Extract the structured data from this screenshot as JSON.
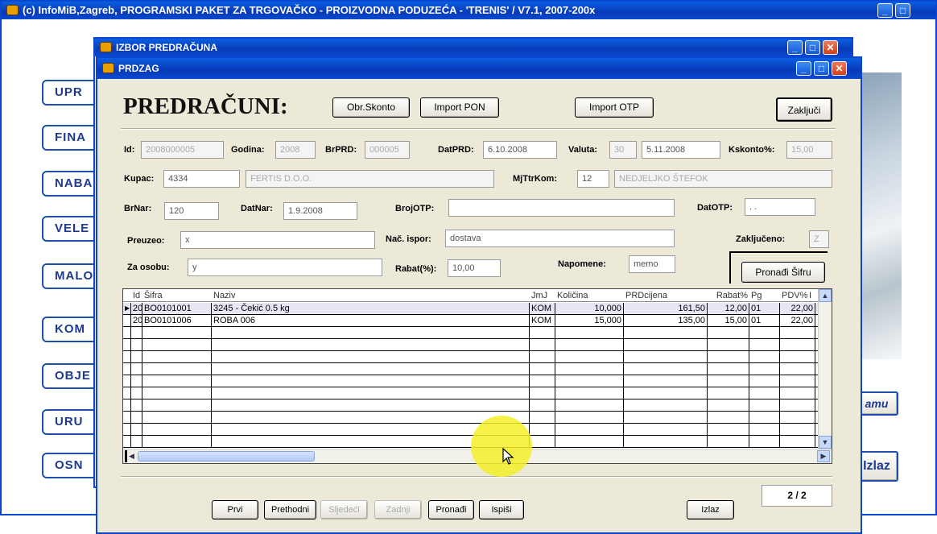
{
  "main_window": {
    "title": "(c) InfoMiB,Zagreb, PROGRAMSKI PAKET ZA TRGOVAČKO - PROIZVODNA PODUZEĆA - 'TRENIS' / V7.1, 2007-200x"
  },
  "left_menu": [
    "UPR",
    "FINA",
    "NABA",
    "VELE",
    "MALO",
    "KOM",
    "OBJE",
    "URU",
    "OSN"
  ],
  "right_buttons": {
    "ramu": "amu",
    "izlaz": "Izlaz"
  },
  "izbor_window": {
    "title": "IZBOR PREDRAČUNA"
  },
  "prdzag": {
    "title": "PRDZAG",
    "heading": "PREDRAČUNI:",
    "buttons": {
      "obr_skonto": "Obr.Skonto",
      "import_pon": "Import PON",
      "import_otp": "Import OTP",
      "zakljuci": "Zaključi",
      "pronadi_sifru": "Pronađi Šifru"
    },
    "fields": {
      "id": {
        "label": "Id:",
        "value": "2008000005"
      },
      "godina": {
        "label": "Godina:",
        "value": "2008"
      },
      "brprd": {
        "label": "BrPRD:",
        "value": "000005"
      },
      "datprd": {
        "label": "DatPRD:",
        "value": "6.10.2008"
      },
      "valuta": {
        "label": "Valuta:",
        "value": "30",
        "date": "5.11.2008"
      },
      "kskonto": {
        "label": "Kskonto%:",
        "value": "15,00"
      },
      "kupac": {
        "label": "Kupac:",
        "value": "4334",
        "name": "FERTIS D.O.O."
      },
      "mjtrtkom": {
        "label": "MjTtrKom:",
        "value": "12",
        "name": "NEDJELJKO ŠTEFOK"
      },
      "brnar": {
        "label": "BrNar:",
        "value": "120"
      },
      "datnar": {
        "label": "DatNar:",
        "value": "1.9.2008"
      },
      "brojotp": {
        "label": "BrojOTP:",
        "value": ""
      },
      "datotp": {
        "label": "DatOTP:",
        "value": ". ."
      },
      "preuzeo": {
        "label": "Preuzeo:",
        "value": "x"
      },
      "nac_ispor": {
        "label": "Nač. ispor:",
        "value": "dostava"
      },
      "zakljuceno": {
        "label": "Zaključeno:",
        "value": "Z"
      },
      "za_osobu": {
        "label": "Za osobu:",
        "value": "y"
      },
      "rabat": {
        "label": "Rabat(%):",
        "value": "10,00"
      },
      "napomene": {
        "label": "Napomene:",
        "value": "memo"
      }
    },
    "grid": {
      "columns": [
        "Id",
        "Šifra",
        "Naziv",
        "JmJ",
        "Količina",
        "PRDcijena",
        "Rabat%",
        "Pg",
        "PDV%",
        "I"
      ],
      "rows": [
        [
          "20",
          "BO0101001",
          "3245 - Čekić 0.5 kg",
          "KOM",
          "10,000",
          "161,50",
          "12,00",
          "01",
          "22,00"
        ],
        [
          "20",
          "BO0101006",
          "ROBA 006",
          "KOM",
          "15,000",
          "135,00",
          "15,00",
          "01",
          "22,00"
        ]
      ]
    },
    "nav": {
      "prvi": "Prvi",
      "prethodni": "Prethodni",
      "sljedeci": "Sljedeći",
      "zadnji": "Zadnji",
      "pronadi": "Pronađi",
      "ispisi": "Ispiši",
      "izlaz": "Izlaz"
    },
    "record_counter": "2 / 2"
  }
}
